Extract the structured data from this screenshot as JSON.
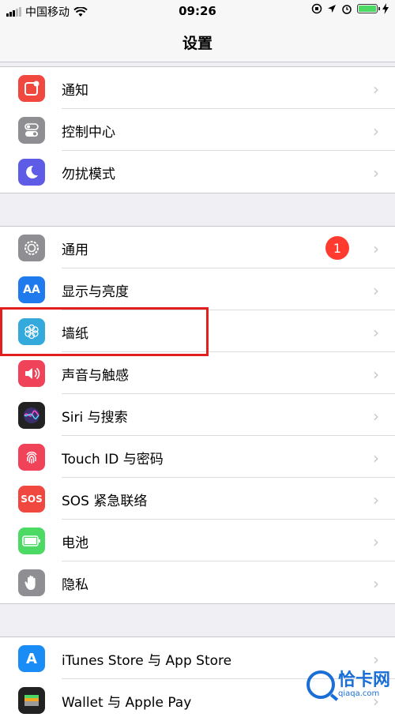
{
  "status_bar": {
    "carrier": "中国移动",
    "time": "09:26"
  },
  "nav": {
    "title": "设置"
  },
  "groups": [
    {
      "items": [
        {
          "label": "通知",
          "icon": "notification-icon",
          "color": "#f0483e"
        },
        {
          "label": "控制中心",
          "icon": "control-center-icon",
          "color": "#8e8e93"
        },
        {
          "label": "勿扰模式",
          "icon": "moon-icon",
          "color": "#5e5ce6"
        }
      ]
    },
    {
      "items": [
        {
          "label": "通用",
          "icon": "gear-icon",
          "color": "#8e8e93",
          "badge": "1"
        },
        {
          "label": "显示与亮度",
          "icon": "display-icon",
          "color": "#1f7aed",
          "glyph": "AA"
        },
        {
          "label": "墙纸",
          "icon": "wallpaper-flower-icon",
          "color": "#34aadc"
        },
        {
          "label": "声音与触感",
          "icon": "speaker-icon",
          "color": "#f0435a"
        },
        {
          "label": "Siri 与搜索",
          "icon": "siri-icon",
          "color": "#222"
        },
        {
          "label": "Touch ID 与密码",
          "icon": "fingerprint-icon",
          "color": "#f0435a"
        },
        {
          "label": "SOS 紧急联络",
          "icon": "sos-icon",
          "color": "#f0483e",
          "glyph": "SOS"
        },
        {
          "label": "电池",
          "icon": "battery-icon",
          "color": "#4cd964"
        },
        {
          "label": "隐私",
          "icon": "hand-icon",
          "color": "#8e8e93"
        }
      ]
    },
    {
      "items": [
        {
          "label": "iTunes Store 与 App Store",
          "icon": "app-store-icon",
          "color": "#1a8cf5",
          "glyph": "A"
        },
        {
          "label": "Wallet 与 Apple Pay",
          "icon": "wallet-icon",
          "color": "#222"
        }
      ]
    }
  ],
  "watermark": {
    "text": "恰卡网",
    "sub": "qiaqa.com"
  }
}
